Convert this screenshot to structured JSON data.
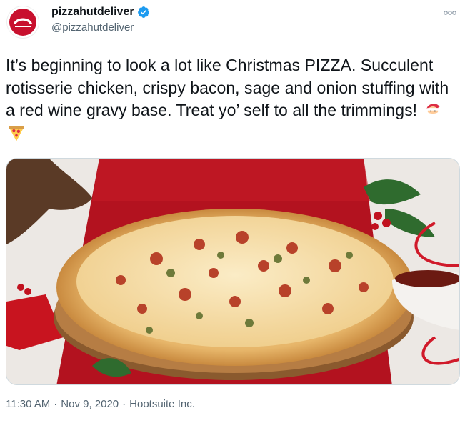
{
  "author": {
    "display_name": "pizzahutdeliver",
    "handle": "@pizzahutdeliver",
    "verified": true,
    "avatar_icon": "pizza-hut-logo"
  },
  "tweet": {
    "text": "It’s beginning to look a lot like Christmas PIZZA. Succulent rotisserie chicken, crispy bacon, sage and onion stuffing with a red wine gravy base. Treat yo’ self to all the trimmings!",
    "emojis": [
      "santa-emoji",
      "pizza-emoji"
    ],
    "image_alt": "Christmas pizza on wooden board with gravy boat"
  },
  "meta": {
    "time": "11:30 AM",
    "separator": "·",
    "date": "Nov 9, 2020",
    "source": "Hootsuite Inc."
  },
  "colors": {
    "verified_blue": "#1d9bf0",
    "secondary_text": "#536471",
    "brand_red": "#c8102e"
  }
}
